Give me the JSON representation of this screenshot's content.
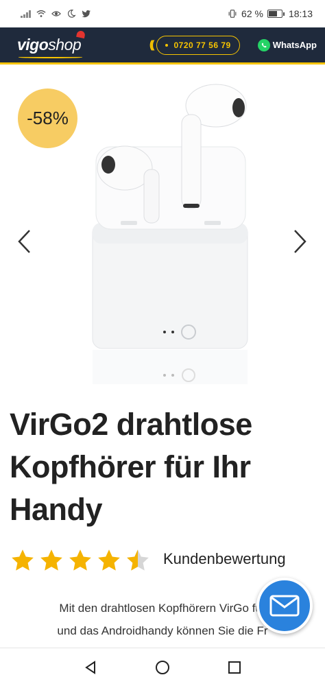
{
  "status_bar": {
    "battery_percent": "62 %",
    "time": "18:13",
    "icons": [
      "signal-icon",
      "wifi-icon",
      "eye-icon",
      "moon-icon",
      "twitter-icon",
      "vibrate-icon",
      "battery-icon"
    ]
  },
  "header": {
    "logo_primary": "vigo",
    "logo_secondary": "shop",
    "phone_number": "0720 77 56 79",
    "whatsapp_label": "WhatsApp",
    "colors": {
      "background": "#1f2a3c",
      "accent": "#f7c400",
      "whatsapp": "#25d366"
    }
  },
  "gallery": {
    "discount_badge": "-58%",
    "badge_color": "#f7cc63",
    "image_subject": "wireless-earbuds-with-charging-case"
  },
  "product": {
    "title": "VirGo2 drahtlose Kopfhörer für Ihr Handy",
    "rating_value": 4.5,
    "rating_max": 5,
    "rating_label": "Kundenbewertung",
    "star_color": "#f5b301",
    "description_line1": "Mit den drahtlosen Kopfhörern VirGo für",
    "description_line2": "und das Androidhandy können Sie die Fr"
  },
  "floating_button": {
    "icon": "mail-icon",
    "color": "#2a82dd"
  },
  "nav_bar": {
    "icons": [
      "back-icon",
      "home-icon",
      "recents-icon"
    ]
  }
}
